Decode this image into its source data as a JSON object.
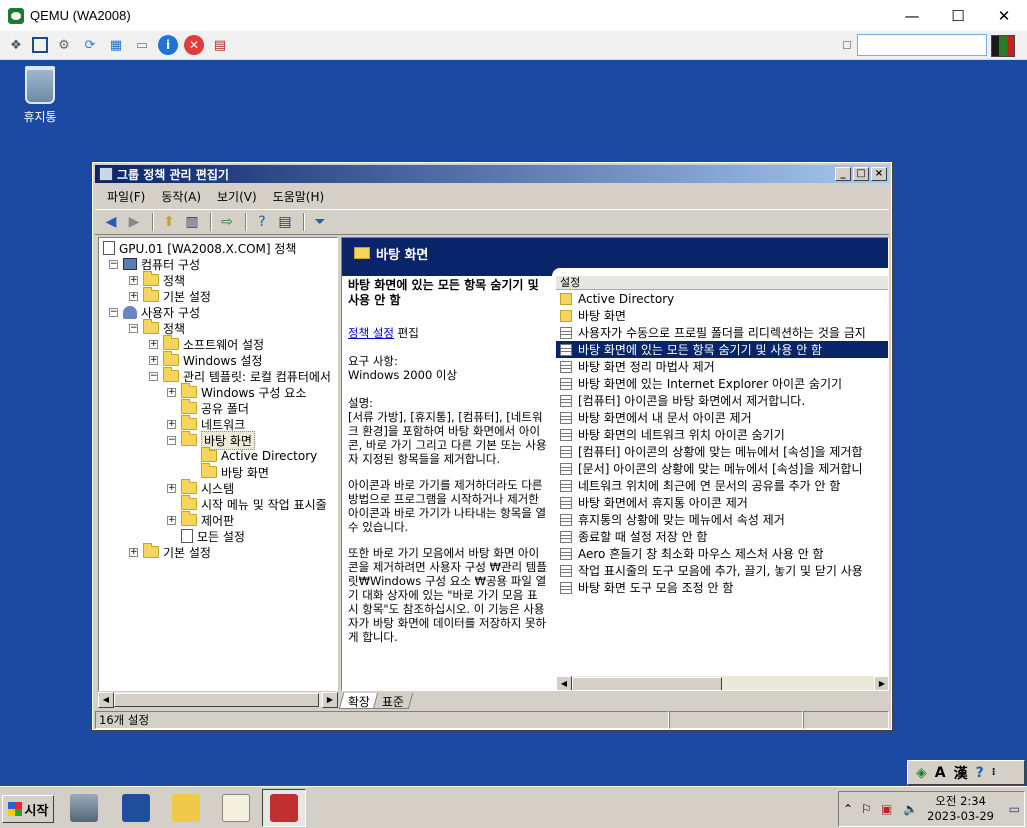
{
  "host": {
    "title": "QEMU (WA2008)",
    "controls": {
      "minimize": "—",
      "maximize": "☐",
      "close": "✕"
    },
    "toolbar_icons": [
      "cube-icon",
      "fullscreen-icon",
      "gear-icon",
      "refresh-icon",
      "windows-icon",
      "usb-icon",
      "info-icon",
      "stop-icon",
      "disk-icon"
    ],
    "info_glyph": "i",
    "stop_glyph": "✕"
  },
  "desktop": {
    "recycle_bin_label": "휴지통"
  },
  "gpedit": {
    "title": "그룹 정책 관리 편집기",
    "menu": [
      "파일(F)",
      "동작(A)",
      "보기(V)",
      "도움말(H)"
    ],
    "tree": {
      "root": "GPU.01 [WA2008.X.COM] 정책",
      "computer": "컴퓨터 구성",
      "c_policy": "정책",
      "c_pref": "기본 설정",
      "user": "사용자 구성",
      "u_policy": "정책",
      "software": "소프트웨어 설정",
      "windows": "Windows 설정",
      "admin": "관리 템플릿: 로컬 컴퓨터에서",
      "wincomp": "Windows 구성 요소",
      "shared": "공유 폴더",
      "network": "네트워크",
      "desktop": "바탕 화면",
      "ad": "Active Directory",
      "desktop2": "바탕 화면",
      "system": "시스템",
      "startmenu": "시작 메뉴 및 작업 표시줄",
      "control": "제어판",
      "allsettings": "모든 설정",
      "u_pref": "기본 설정"
    },
    "pane_header": "바탕 화면",
    "description": {
      "title": "바탕 화면에 있는 모든 항목 숨기기 및 사용 안 함",
      "edit_link": "정책 설정",
      "edit_suffix": " 편집",
      "req_label": "요구 사항:",
      "req_value": "Windows 2000 이상",
      "desc_label": "설명:",
      "p1": "[서류 가방], [휴지통], [컴퓨터], [네트워크 환경]을 포함하여 바탕 화면에서 아이콘, 바로 가기 그리고 다른 기본 또는 사용자 지정된 항목들을 제거합니다.",
      "p2": "아이콘과 바로 가기를 제거하더라도 다른 방법으로 프로그램을 시작하거나 제거한 아이콘과 바로 가기가 나타내는 항목을 열 수 있습니다.",
      "p3": "또한 바로 가기 모음에서 바탕 화면 아이콘을 제거하려면 사용자 구성 ₩관리 템플릿₩Windows 구성 요소 ₩공용 파일 열기 대화 상자에 있는 \"바로 가기 모음 표시 항목\"도 참조하십시오. 이 기능은 사용자가 바탕 화면에 데이터를 저장하지 못하게 합니다."
    },
    "list_header": "설정",
    "list": [
      {
        "type": "folder",
        "text": "Active Directory"
      },
      {
        "type": "folder",
        "text": "바탕 화면"
      },
      {
        "type": "setting",
        "text": "사용자가 수동으로 프로필 폴더를 리디렉션하는 것을 금지"
      },
      {
        "type": "setting",
        "text": "바탕 화면에 있는 모든 항목 숨기기 및 사용 안 함",
        "selected": true
      },
      {
        "type": "setting",
        "text": "바탕 화면 정리 마법사 제거"
      },
      {
        "type": "setting",
        "text": "바탕 화면에 있는 Internet Explorer 아이콘 숨기기"
      },
      {
        "type": "setting",
        "text": "[컴퓨터] 아이콘을 바탕 화면에서 제거합니다."
      },
      {
        "type": "setting",
        "text": "바탕 화면에서 내 문서 아이콘 제거"
      },
      {
        "type": "setting",
        "text": "바탕 화면의 네트워크 위치 아이콘 숨기기"
      },
      {
        "type": "setting",
        "text": "[컴퓨터] 아이콘의 상황에 맞는 메뉴에서 [속성]을 제거합"
      },
      {
        "type": "setting",
        "text": "[문서] 아이콘의 상황에 맞는 메뉴에서 [속성]을 제거합니"
      },
      {
        "type": "setting",
        "text": "네트워크 위치에 최근에 연 문서의 공유를 추가 안 함"
      },
      {
        "type": "setting",
        "text": "바탕 화면에서 휴지통 아이콘 제거"
      },
      {
        "type": "setting",
        "text": "휴지통의 상황에 맞는 메뉴에서 속성 제거"
      },
      {
        "type": "setting",
        "text": "종료할 때 설정 저장 안 함"
      },
      {
        "type": "setting",
        "text": "Aero 흔들기 창 최소화 마우스 제스처 사용 안 함"
      },
      {
        "type": "setting",
        "text": "작업 표시줄의 도구 모음에 추가, 끌기, 놓기 및 닫기 사용"
      },
      {
        "type": "setting",
        "text": "바탕 화면 도구 모음 조정 안 함"
      }
    ],
    "tabs": [
      "확장",
      "표준"
    ],
    "status": "16개 설정"
  },
  "taskbar": {
    "start_label": "시작",
    "clock_time": "오전 2:34",
    "clock_date": "2023-03-29",
    "langbar": {
      "ime": "A",
      "hanja": "漢",
      "help": "?"
    }
  }
}
